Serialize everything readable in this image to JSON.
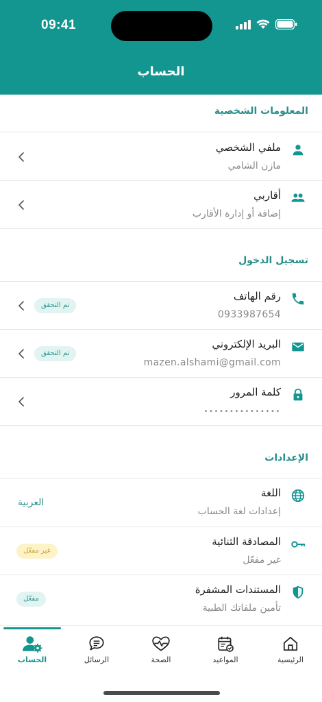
{
  "status_bar": {
    "time": "09:41"
  },
  "header": {
    "title": "الحساب"
  },
  "sections": {
    "personal": {
      "title": "المعلومات الشخصية",
      "profile": {
        "label": "ملفي الشخصي",
        "sub": "مازن الشامي",
        "icon": "person-icon"
      },
      "relatives": {
        "label": "أقاربي",
        "sub": "إضافة أو إدارة الأقارب",
        "icon": "people-icon"
      }
    },
    "login": {
      "title": "تسجيل الدخول",
      "phone": {
        "label": "رقم الهاتف",
        "sub": "0933987654",
        "badge": "تم التحقق",
        "icon": "phone-icon"
      },
      "email": {
        "label": "البريد الإلكتروني",
        "sub": "mazen.alshami@gmail.com",
        "badge": "تم التحقق",
        "icon": "mail-icon"
      },
      "password": {
        "label": "كلمة المرور",
        "sub": "•••••••••••••••",
        "icon": "lock-icon"
      }
    },
    "settings": {
      "title": "الإعدادات",
      "language": {
        "label": "اللغة",
        "sub": "إعدادات لغة الحساب",
        "value": "العربية",
        "icon": "globe-icon"
      },
      "two_factor": {
        "label": "المصادقة الثنائية",
        "sub": "غير مفعّل",
        "badge": "غير مفعّل",
        "icon": "key-icon"
      },
      "encrypted_docs": {
        "label": "المستندات المشفرة",
        "sub": "تأمين ملفاتك الطبية",
        "badge": "مفعّل",
        "icon": "shield-icon"
      }
    }
  },
  "tabs": [
    {
      "label": "الرئيسية",
      "icon": "home-icon"
    },
    {
      "label": "المواعيد",
      "icon": "calendar-icon"
    },
    {
      "label": "الصحة",
      "icon": "heart-pulse-icon"
    },
    {
      "label": "الرسائل",
      "icon": "chat-icon"
    },
    {
      "label": "الحساب",
      "icon": "account-gear-icon",
      "active": true
    }
  ],
  "colors": {
    "primary": "#139590",
    "accent_text": "#2a8f8a",
    "badge_green_bg": "#e1f4f1",
    "badge_yellow_bg": "#fdf3c9"
  }
}
